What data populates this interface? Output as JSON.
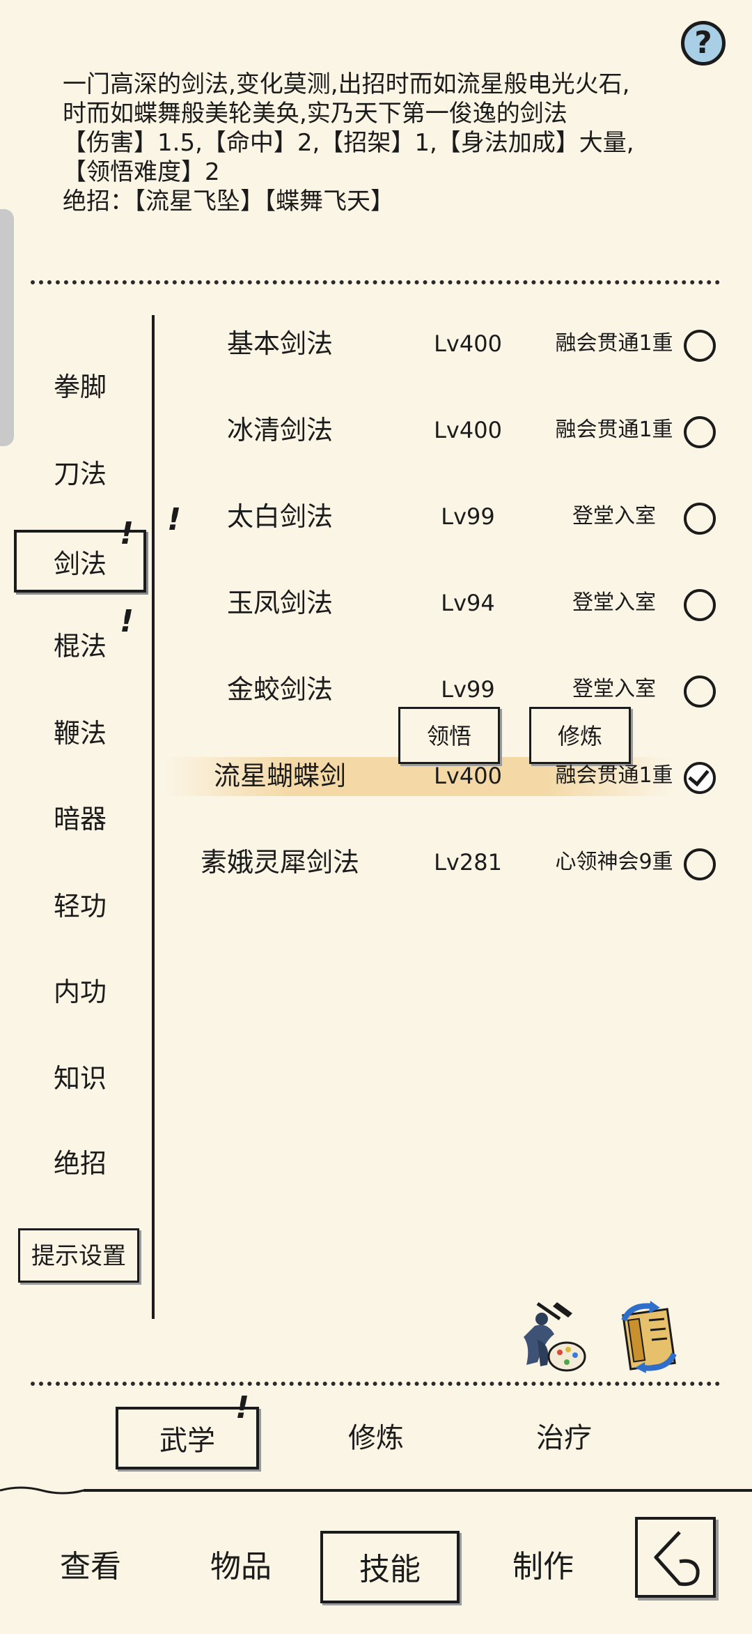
{
  "help": {
    "label": "?"
  },
  "description": {
    "lines": [
      "一门高深的剑法,变化莫测,出招时而如流星般电光火石,",
      "时而如蝶舞般美轮美奂,实乃天下第一俊逸的剑法",
      "【伤害】1.5,【命中】2,【招架】1,【身法加成】大量,",
      "【领悟难度】2",
      "绝招：【流星飞坠】【蝶舞飞天】"
    ]
  },
  "categories": [
    {
      "label": "拳脚",
      "active": false,
      "alert": false
    },
    {
      "label": "刀法",
      "active": false,
      "alert": false
    },
    {
      "label": "剑法",
      "active": true,
      "alert": true
    },
    {
      "label": "棍法",
      "active": false,
      "alert": true
    },
    {
      "label": "鞭法",
      "active": false,
      "alert": false
    },
    {
      "label": "暗器",
      "active": false,
      "alert": false
    },
    {
      "label": "轻功",
      "active": false,
      "alert": false
    },
    {
      "label": "内功",
      "active": false,
      "alert": false
    },
    {
      "label": "知识",
      "active": false,
      "alert": false
    },
    {
      "label": "绝招",
      "active": false,
      "alert": false
    }
  ],
  "alert_mark": "!",
  "tip_settings_label": "提示设置",
  "skills": [
    {
      "name": "基本剑法",
      "level": "Lv400",
      "realm": "融会贯通1重",
      "selected": false
    },
    {
      "name": "冰清剑法",
      "level": "Lv400",
      "realm": "融会贯通1重",
      "selected": false
    },
    {
      "name": "太白剑法",
      "level": "Lv99",
      "realm": "登堂入室",
      "selected": false
    },
    {
      "name": "玉凤剑法",
      "level": "Lv94",
      "realm": "登堂入室",
      "selected": false
    },
    {
      "name": "金蛟剑法",
      "level": "Lv99",
      "realm": "登堂入室",
      "selected": false
    },
    {
      "name": "流星蝴蝶剑",
      "level": "Lv400",
      "realm": "融会贯通1重",
      "selected": true
    },
    {
      "name": "素娥灵犀剑法",
      "level": "Lv281",
      "realm": "心领神会9重",
      "selected": false
    }
  ],
  "actions": {
    "comprehend": "领悟",
    "practice": "修炼"
  },
  "icons": {
    "style_icon": "swordsman-palette-icon",
    "scroll_icon": "scroll-swap-icon"
  },
  "sub_tabs": [
    {
      "label": "武学",
      "active": true,
      "alert": true
    },
    {
      "label": "修炼",
      "active": false,
      "alert": false
    },
    {
      "label": "治疗",
      "active": false,
      "alert": false
    }
  ],
  "main_tabs": [
    {
      "label": "查看",
      "active": false
    },
    {
      "label": "物品",
      "active": false
    },
    {
      "label": "技能",
      "active": true
    },
    {
      "label": "制作",
      "active": false
    }
  ],
  "colors": {
    "background": "#fbf5e6",
    "ink": "#1b1b1b",
    "highlight": "#f4d9a6",
    "help": "#a8cfe6"
  }
}
